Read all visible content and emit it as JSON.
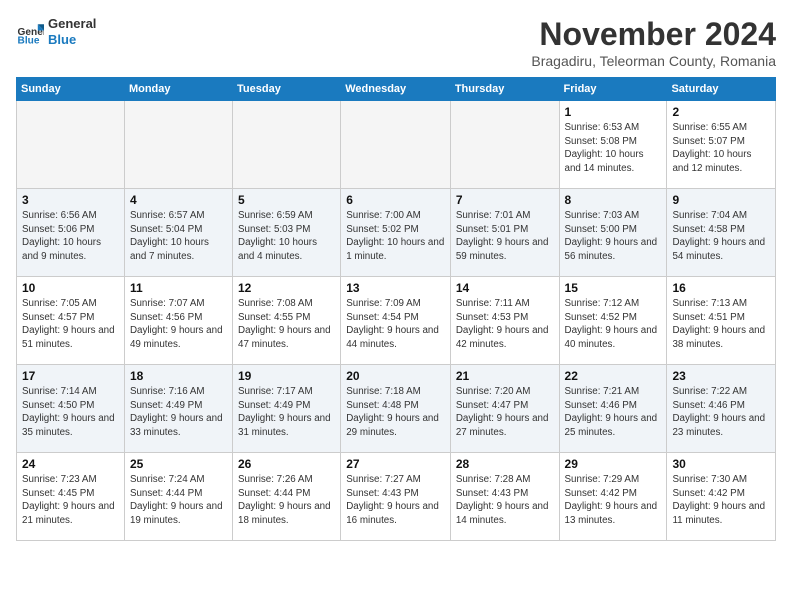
{
  "header": {
    "logo_general": "General",
    "logo_blue": "Blue",
    "month_title": "November 2024",
    "subtitle": "Bragadiru, Teleorman County, Romania"
  },
  "weekdays": [
    "Sunday",
    "Monday",
    "Tuesday",
    "Wednesday",
    "Thursday",
    "Friday",
    "Saturday"
  ],
  "weeks": [
    [
      {
        "day": "",
        "info": ""
      },
      {
        "day": "",
        "info": ""
      },
      {
        "day": "",
        "info": ""
      },
      {
        "day": "",
        "info": ""
      },
      {
        "day": "",
        "info": ""
      },
      {
        "day": "1",
        "info": "Sunrise: 6:53 AM\nSunset: 5:08 PM\nDaylight: 10 hours and 14 minutes."
      },
      {
        "day": "2",
        "info": "Sunrise: 6:55 AM\nSunset: 5:07 PM\nDaylight: 10 hours and 12 minutes."
      }
    ],
    [
      {
        "day": "3",
        "info": "Sunrise: 6:56 AM\nSunset: 5:06 PM\nDaylight: 10 hours and 9 minutes."
      },
      {
        "day": "4",
        "info": "Sunrise: 6:57 AM\nSunset: 5:04 PM\nDaylight: 10 hours and 7 minutes."
      },
      {
        "day": "5",
        "info": "Sunrise: 6:59 AM\nSunset: 5:03 PM\nDaylight: 10 hours and 4 minutes."
      },
      {
        "day": "6",
        "info": "Sunrise: 7:00 AM\nSunset: 5:02 PM\nDaylight: 10 hours and 1 minute."
      },
      {
        "day": "7",
        "info": "Sunrise: 7:01 AM\nSunset: 5:01 PM\nDaylight: 9 hours and 59 minutes."
      },
      {
        "day": "8",
        "info": "Sunrise: 7:03 AM\nSunset: 5:00 PM\nDaylight: 9 hours and 56 minutes."
      },
      {
        "day": "9",
        "info": "Sunrise: 7:04 AM\nSunset: 4:58 PM\nDaylight: 9 hours and 54 minutes."
      }
    ],
    [
      {
        "day": "10",
        "info": "Sunrise: 7:05 AM\nSunset: 4:57 PM\nDaylight: 9 hours and 51 minutes."
      },
      {
        "day": "11",
        "info": "Sunrise: 7:07 AM\nSunset: 4:56 PM\nDaylight: 9 hours and 49 minutes."
      },
      {
        "day": "12",
        "info": "Sunrise: 7:08 AM\nSunset: 4:55 PM\nDaylight: 9 hours and 47 minutes."
      },
      {
        "day": "13",
        "info": "Sunrise: 7:09 AM\nSunset: 4:54 PM\nDaylight: 9 hours and 44 minutes."
      },
      {
        "day": "14",
        "info": "Sunrise: 7:11 AM\nSunset: 4:53 PM\nDaylight: 9 hours and 42 minutes."
      },
      {
        "day": "15",
        "info": "Sunrise: 7:12 AM\nSunset: 4:52 PM\nDaylight: 9 hours and 40 minutes."
      },
      {
        "day": "16",
        "info": "Sunrise: 7:13 AM\nSunset: 4:51 PM\nDaylight: 9 hours and 38 minutes."
      }
    ],
    [
      {
        "day": "17",
        "info": "Sunrise: 7:14 AM\nSunset: 4:50 PM\nDaylight: 9 hours and 35 minutes."
      },
      {
        "day": "18",
        "info": "Sunrise: 7:16 AM\nSunset: 4:49 PM\nDaylight: 9 hours and 33 minutes."
      },
      {
        "day": "19",
        "info": "Sunrise: 7:17 AM\nSunset: 4:49 PM\nDaylight: 9 hours and 31 minutes."
      },
      {
        "day": "20",
        "info": "Sunrise: 7:18 AM\nSunset: 4:48 PM\nDaylight: 9 hours and 29 minutes."
      },
      {
        "day": "21",
        "info": "Sunrise: 7:20 AM\nSunset: 4:47 PM\nDaylight: 9 hours and 27 minutes."
      },
      {
        "day": "22",
        "info": "Sunrise: 7:21 AM\nSunset: 4:46 PM\nDaylight: 9 hours and 25 minutes."
      },
      {
        "day": "23",
        "info": "Sunrise: 7:22 AM\nSunset: 4:46 PM\nDaylight: 9 hours and 23 minutes."
      }
    ],
    [
      {
        "day": "24",
        "info": "Sunrise: 7:23 AM\nSunset: 4:45 PM\nDaylight: 9 hours and 21 minutes."
      },
      {
        "day": "25",
        "info": "Sunrise: 7:24 AM\nSunset: 4:44 PM\nDaylight: 9 hours and 19 minutes."
      },
      {
        "day": "26",
        "info": "Sunrise: 7:26 AM\nSunset: 4:44 PM\nDaylight: 9 hours and 18 minutes."
      },
      {
        "day": "27",
        "info": "Sunrise: 7:27 AM\nSunset: 4:43 PM\nDaylight: 9 hours and 16 minutes."
      },
      {
        "day": "28",
        "info": "Sunrise: 7:28 AM\nSunset: 4:43 PM\nDaylight: 9 hours and 14 minutes."
      },
      {
        "day": "29",
        "info": "Sunrise: 7:29 AM\nSunset: 4:42 PM\nDaylight: 9 hours and 13 minutes."
      },
      {
        "day": "30",
        "info": "Sunrise: 7:30 AM\nSunset: 4:42 PM\nDaylight: 9 hours and 11 minutes."
      }
    ]
  ]
}
